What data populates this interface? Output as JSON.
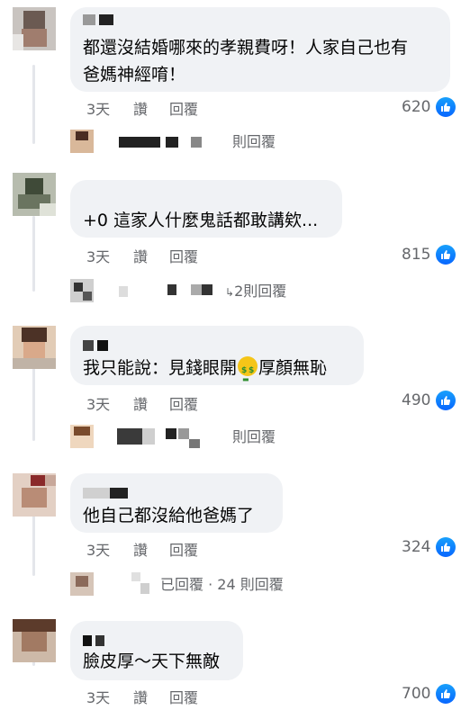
{
  "comments": [
    {
      "text_lines": [
        "都還沒結婚哪來的孝親費呀！人家自己也有",
        "爸媽神經唷！"
      ],
      "time": "3天",
      "like_label": "讚",
      "reply_label": "回覆",
      "reactions": "620",
      "replies_summary": "則回覆"
    },
    {
      "text_lines": [
        "+0 這家人什麼鬼話都敢講欸..."
      ],
      "time": "3天",
      "like_label": "讚",
      "reply_label": "回覆",
      "reactions": "815",
      "replies_summary": "2則回覆"
    },
    {
      "text_before_emoji": "我只能說：見錢眼開",
      "emoji": "money-mouth-face",
      "text_after_emoji": "厚顏無恥",
      "time": "3天",
      "like_label": "讚",
      "reply_label": "回覆",
      "reactions": "490",
      "replies_summary": "則回覆"
    },
    {
      "text_lines": [
        "他自己都沒給他爸媽了"
      ],
      "time": "3天",
      "like_label": "讚",
      "reply_label": "回覆",
      "reactions": "324",
      "replies_summary": "已回覆 · 24 則回覆"
    },
    {
      "text_lines": [
        "臉皮厚～天下無敵"
      ],
      "time": "3天",
      "like_label": "讚",
      "reply_label": "回覆",
      "reactions": "700"
    }
  ],
  "colors": {
    "bubble_bg": "#f0f2f5",
    "meta_text": "#65676b",
    "like_blue": "#0866ff",
    "thread_line": "#e4e6eb"
  }
}
